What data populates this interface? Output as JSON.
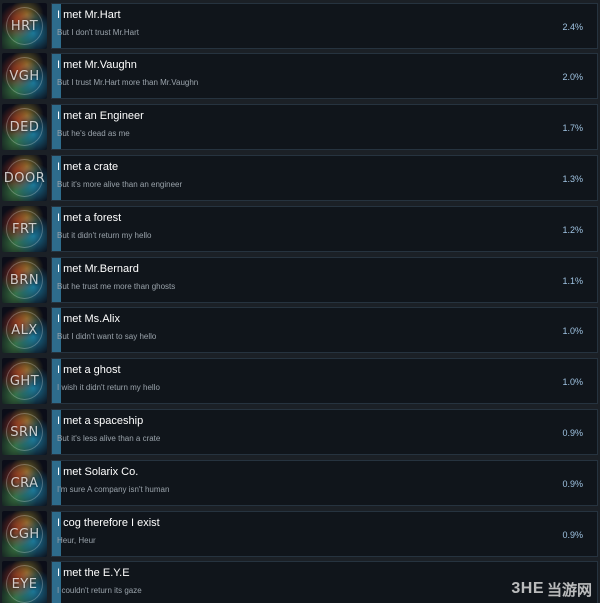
{
  "achievements": [
    {
      "code": "HRT",
      "title": "I met Mr.Hart",
      "desc": "But I don't trust Mr.Hart",
      "pct": "2.4%",
      "fill": 0.017
    },
    {
      "code": "VGH",
      "title": "I met Mr.Vaughn",
      "desc": "But I trust Mr.Hart more than Mr.Vaughn",
      "pct": "2.0%",
      "fill": 0.014
    },
    {
      "code": "DED",
      "title": "I met an Engineer",
      "desc": "But he's dead as me",
      "pct": "1.7%",
      "fill": 0.012
    },
    {
      "code": "DOOR",
      "title": "I met a crate",
      "desc": "But it's more alive than an engineer",
      "pct": "1.3%",
      "fill": 0.009
    },
    {
      "code": "FRT",
      "title": "I met a forest",
      "desc": "But it didn't return my hello",
      "pct": "1.2%",
      "fill": 0.009
    },
    {
      "code": "BRN",
      "title": "I met Mr.Bernard",
      "desc": "But he trust me more than ghosts",
      "pct": "1.1%",
      "fill": 0.008
    },
    {
      "code": "ALX",
      "title": "I met Ms.Alix",
      "desc": "But I didn't want to say hello",
      "pct": "1.0%",
      "fill": 0.007
    },
    {
      "code": "GHT",
      "title": "I met a ghost",
      "desc": "I wish it didn't return my hello",
      "pct": "1.0%",
      "fill": 0.007
    },
    {
      "code": "SRN",
      "title": "I met a spaceship",
      "desc": "But it's less alive than a crate",
      "pct": "0.9%",
      "fill": 0.006
    },
    {
      "code": "CRA",
      "title": "I met Solarix Co.",
      "desc": "I'm sure A company isn't human",
      "pct": "0.9%",
      "fill": 0.006
    },
    {
      "code": "CGH",
      "title": "I cog therefore I exist",
      "desc": "Heur, Heur",
      "pct": "0.9%",
      "fill": 0.006
    },
    {
      "code": "EYE",
      "title": "I met the E.Y.E",
      "desc": "I couldn't return its gaze",
      "pct": "",
      "fill": 0.006
    }
  ],
  "watermark": {
    "en": "3HE",
    "cn": "当游网"
  },
  "colors": {
    "background": "#1b2026",
    "panel": "#10151b",
    "border": "#26333f",
    "bar": "#2e6c8c",
    "percent": "#9fc3e2"
  }
}
